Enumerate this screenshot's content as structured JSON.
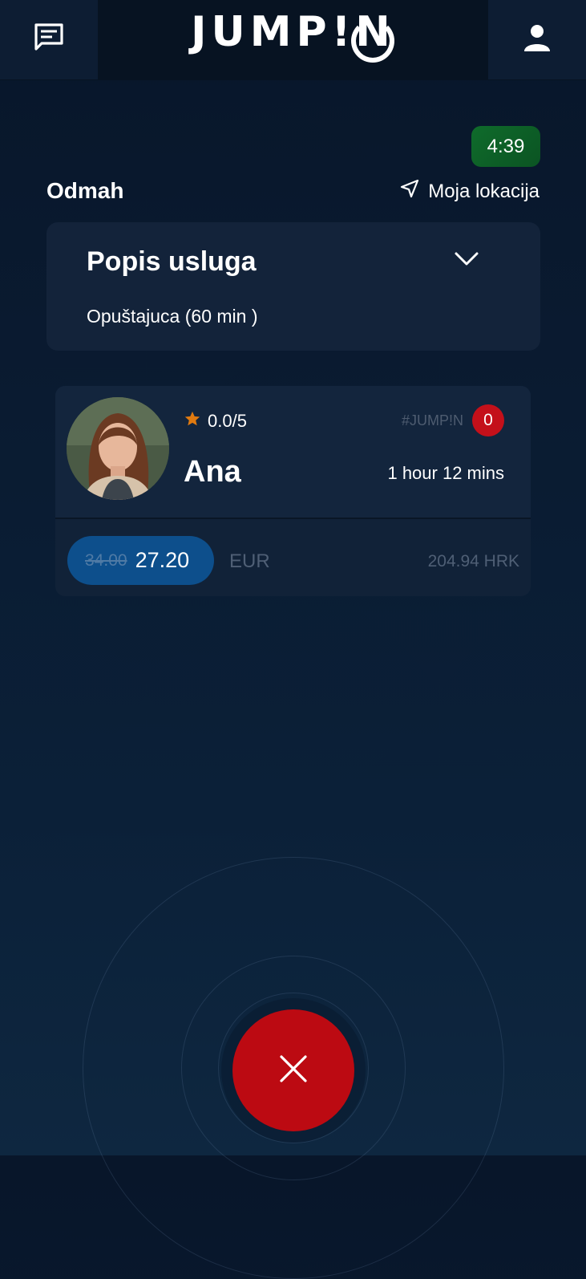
{
  "header": {
    "logo_text": "JUMP!N",
    "left_icon": "chat-icon",
    "right_icon": "user-icon"
  },
  "timer": "4:39",
  "booking": {
    "when_label": "Odmah",
    "location_label": "Moja lokacija"
  },
  "services": {
    "title": "Popis usluga",
    "selected": "Opuštajuca (60 min )"
  },
  "professional": {
    "rating": "0.0/5",
    "name": "Ana",
    "tag": "#JUMP!N",
    "badge_count": "0",
    "eta": "1 hour 12 mins",
    "old_price": "34.00",
    "price": "27.20",
    "currency": "EUR",
    "alt_price": "204.94 HRK"
  },
  "colors": {
    "timer_green": "#0f6b2b",
    "cancel_red": "#bc0a12",
    "price_blue": "#0d4f8c",
    "star_orange": "#e07a10"
  }
}
